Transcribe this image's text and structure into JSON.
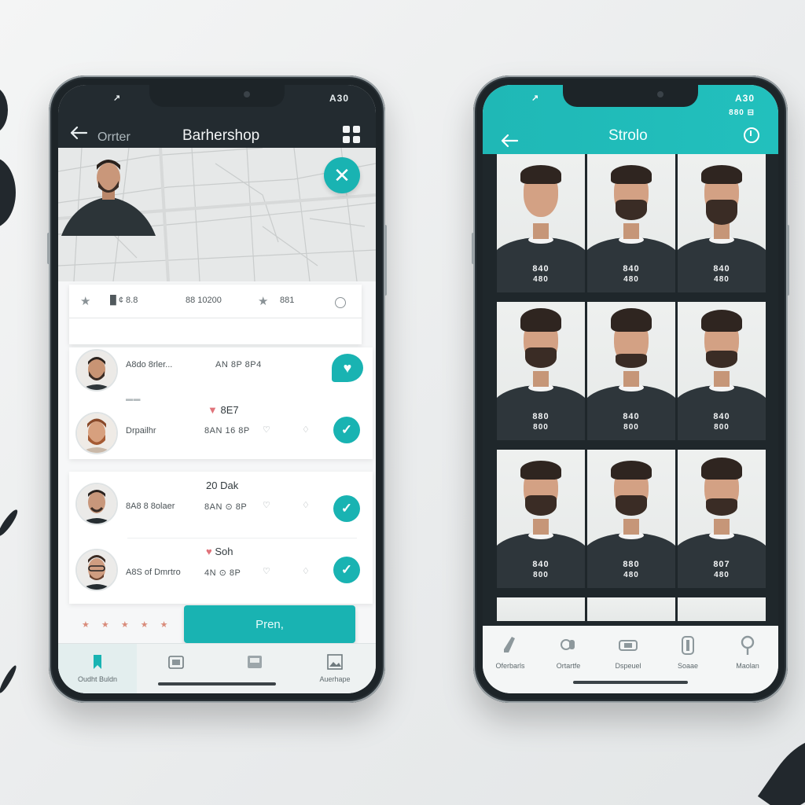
{
  "left_phone": {
    "status": {
      "time": "↗",
      "right": "A30"
    },
    "header": {
      "back_label": "Orrter",
      "title": "Barhershop"
    },
    "info_card": {
      "left_text": "█ ¢ 8.8",
      "middle_text": "88 10200",
      "right_text": "881"
    },
    "list_card_1": {
      "rows": [
        {
          "name": "A8do 8rler...",
          "meta": "AN 8P 8P4",
          "top": ""
        },
        {
          "name": "Drpailhr",
          "meta": "8AN 16 8P",
          "top": "8E7"
        }
      ],
      "divider_label": "▬▬"
    },
    "list_card_2": {
      "rows": [
        {
          "name": "8A8 8 8olaer",
          "meta": "8AN ⊙ 8P",
          "top": "20 Dak"
        },
        {
          "name": "A8S of Dmrtro",
          "meta": "4N ⊙ 8P",
          "top": "Soh"
        }
      ]
    },
    "rating": "★ ★ ★ ★ ★",
    "primary_button": "Pren,",
    "tabs": [
      {
        "label": "Oudht Buldn",
        "icon": "bookmark-icon"
      },
      {
        "label": "",
        "icon": "calendar-icon"
      },
      {
        "label": "",
        "icon": "gallery-icon"
      },
      {
        "label": "Auerhape",
        "icon": "picture-icon"
      }
    ],
    "colors": {
      "accent": "#19b3b2",
      "header": "#232b30"
    }
  },
  "right_phone": {
    "status": {
      "left": "↗",
      "right": "A30",
      "sub": "880 ⊟"
    },
    "header": {
      "title": "Strolo"
    },
    "gallery": [
      {
        "p1": "840",
        "p2": "480"
      },
      {
        "p1": "840",
        "p2": "480"
      },
      {
        "p1": "840",
        "p2": "480"
      },
      {
        "p1": "880",
        "p2": "800"
      },
      {
        "p1": "840",
        "p2": "800"
      },
      {
        "p1": "840",
        "p2": "800"
      },
      {
        "p1": "840",
        "p2": "800"
      },
      {
        "p1": "880",
        "p2": "480"
      },
      {
        "p1": "807",
        "p2": "480"
      }
    ],
    "tabs": [
      {
        "label": "Oferbarls",
        "icon": "clippers-icon"
      },
      {
        "label": "Ortartfe",
        "icon": "shaver-icon"
      },
      {
        "label": "Dspeuel",
        "icon": "wallet-icon"
      },
      {
        "label": "Soaae",
        "icon": "barber-pole-icon"
      },
      {
        "label": "Maolan",
        "icon": "location-icon"
      }
    ],
    "colors": {
      "accent": "#1fb8b6"
    }
  }
}
